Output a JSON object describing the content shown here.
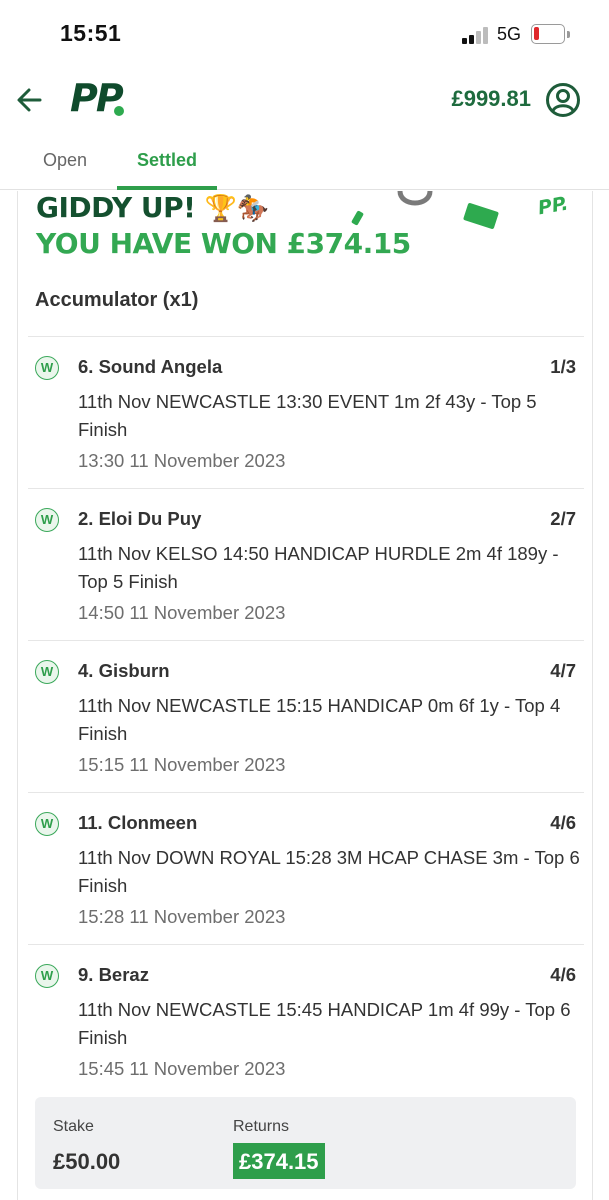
{
  "status_bar": {
    "time": "15:51",
    "network": "5G",
    "battery_level": 0.12
  },
  "header": {
    "back_icon": "arrow-left-icon",
    "logo_text": "PP",
    "balance": "£999.81",
    "account_icon": "user-circle-icon"
  },
  "tabs": [
    {
      "label": "Open",
      "active": false
    },
    {
      "label": "Settled",
      "active": true
    }
  ],
  "banner": {
    "line1": "GIDDY UP!",
    "line1_emoji": "🏆🏇",
    "line2": "YOU HAVE WON £374.15",
    "logo_small": "PP."
  },
  "bet": {
    "type": "Accumulator (x1)",
    "legs": [
      {
        "status": "W",
        "selection": "6. Sound Angela",
        "odds": "1/3",
        "description": "11th Nov NEWCASTLE 13:30 EVENT 1m 2f 43y - Top 5 Finish",
        "time": "13:30 11 November 2023"
      },
      {
        "status": "W",
        "selection": "2. Eloi Du Puy",
        "odds": "2/7",
        "description": "11th Nov KELSO 14:50 HANDICAP HURDLE 2m 4f 189y - Top 5 Finish",
        "time": "14:50 11 November 2023"
      },
      {
        "status": "W",
        "selection": "4. Gisburn",
        "odds": "4/7",
        "description": "11th Nov NEWCASTLE 15:15 HANDICAP 0m 6f 1y - Top 4 Finish",
        "time": "15:15 11 November 2023"
      },
      {
        "status": "W",
        "selection": "11. Clonmeen",
        "odds": "4/6",
        "description": "11th Nov DOWN ROYAL 15:28 3M HCAP CHASE 3m - Top 6 Finish",
        "time": "15:28 11 November 2023"
      },
      {
        "status": "W",
        "selection": "9. Beraz",
        "odds": "4/6",
        "description": "11th Nov NEWCASTLE 15:45 HANDICAP 1m 4f 99y - Top 6 Finish",
        "time": "15:45 11 November 2023"
      }
    ],
    "stake_label": "Stake",
    "stake": "£50.00",
    "returns_label": "Returns",
    "returns": "£374.15"
  },
  "colors": {
    "brand_dark": "#0f4b2c",
    "brand_green": "#2e9e4b",
    "win_badge": "#3aa85a"
  }
}
